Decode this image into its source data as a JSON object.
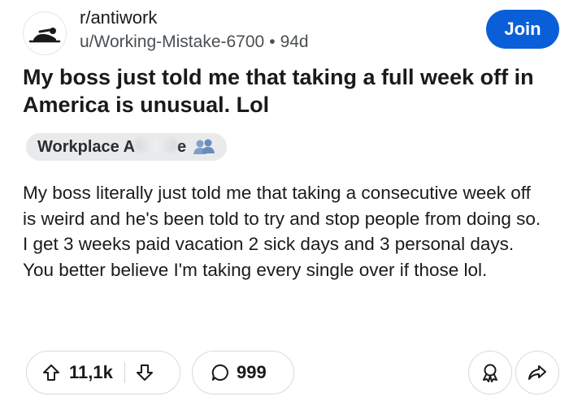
{
  "post": {
    "subreddit": "r/antiwork",
    "author": "u/Working-Mistake-6700",
    "separator": "•",
    "age": "94d",
    "join_label": "Join",
    "title": "My boss just told me that taking a full week off in America is unusual. Lol",
    "flair": {
      "text_start": "Workplace A",
      "text_end": "e",
      "icon": "people-icon"
    },
    "body": "My boss literally just told me that taking a consecutive week off is weird and he's been told to try and stop people from doing so. I get 3 weeks paid vacation 2 sick days and 3 personal days. You better believe I'm taking every single over if those lol."
  },
  "actions": {
    "upvotes": "11,1k",
    "comments": "999",
    "icons": [
      "upvote-icon",
      "downvote-icon",
      "comment-icon",
      "award-icon",
      "share-icon"
    ]
  },
  "colors": {
    "accent": "#0a5fd8",
    "text": "#1a1a1b",
    "muted": "#4a4f53",
    "flair_bg": "#e9eaeb"
  }
}
